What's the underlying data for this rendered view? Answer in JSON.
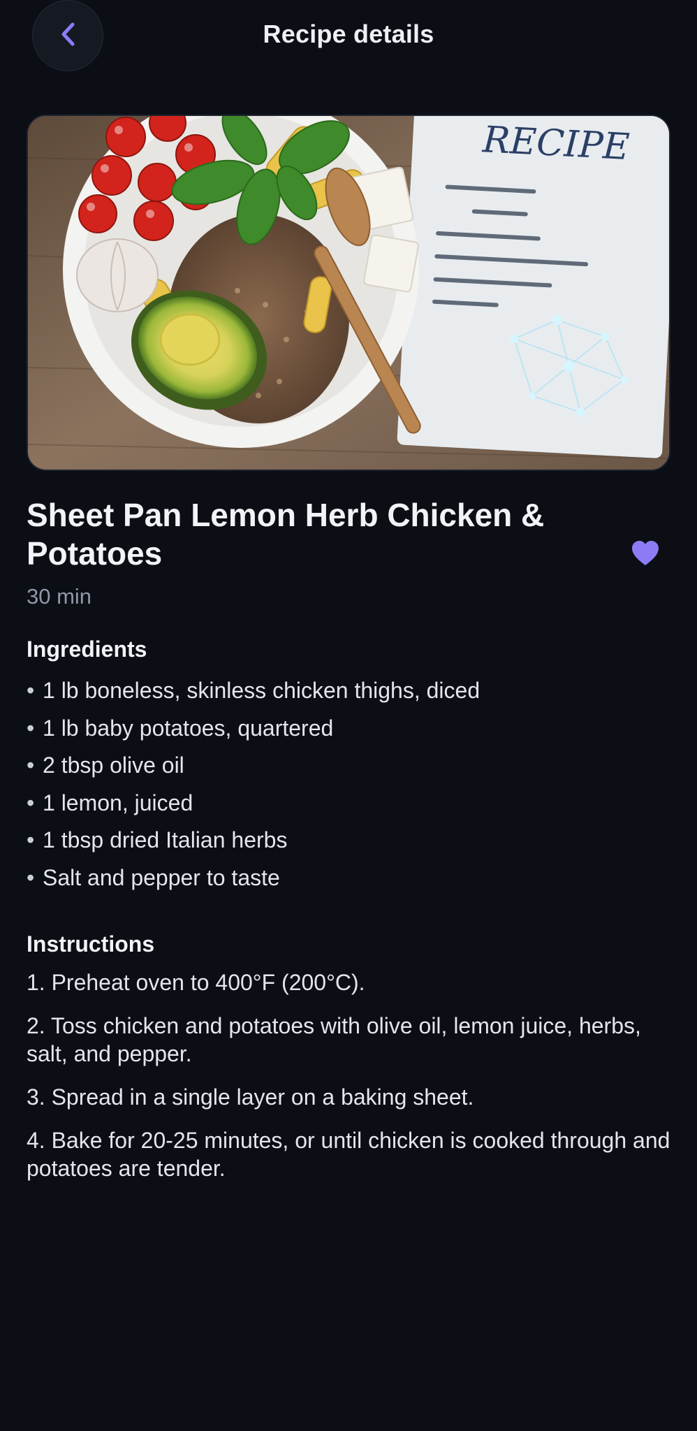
{
  "header": {
    "title": "Recipe details",
    "back_icon": "chevron-left-icon"
  },
  "recipe": {
    "title": "Sheet Pan Lemon Herb Chicken & Potatoes",
    "duration": "30 min",
    "favorite_icon": "heart-icon",
    "favorited": true,
    "image_card_text": "RECIPE"
  },
  "ingredients": {
    "heading": "Ingredients",
    "items": [
      "1 lb boneless, skinless chicken thighs, diced",
      "1 lb baby potatoes, quartered",
      "2 tbsp olive oil",
      "1 lemon, juiced",
      "1 tbsp dried Italian herbs",
      "Salt and pepper to taste"
    ]
  },
  "instructions": {
    "heading": "Instructions",
    "steps": [
      "1. Preheat oven to 400°F (200°C).",
      "2. Toss chicken and potatoes with olive oil, lemon juice, herbs, salt, and pepper.",
      "3. Spread in a single layer on a baking sheet.",
      "4. Bake for 20-25 minutes, or until chicken is cooked through and potatoes are tender."
    ]
  },
  "colors": {
    "background": "#0b0e14",
    "accent": "#8b7cf6",
    "muted_text": "#8f97a8"
  }
}
